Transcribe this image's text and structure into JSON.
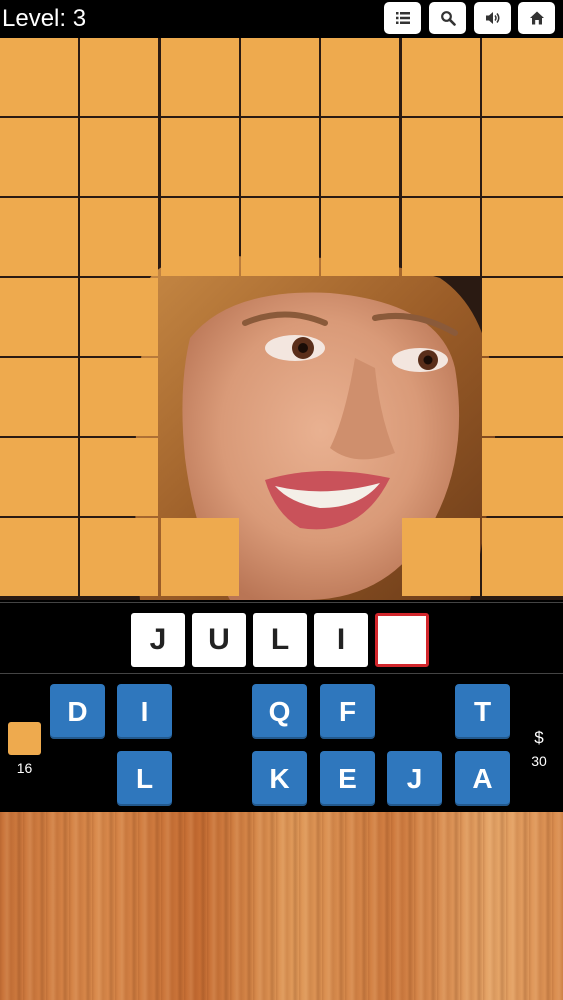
{
  "header": {
    "level_label": "Level: 3",
    "buttons": [
      {
        "name": "list-icon"
      },
      {
        "name": "search-icon"
      },
      {
        "name": "volume-icon"
      },
      {
        "name": "home-icon"
      }
    ]
  },
  "puzzle": {
    "grid_columns": 7,
    "grid_rows": 7,
    "tile_color": "#eeaa4e",
    "revealed_tiles": [
      [
        3,
        2
      ],
      [
        3,
        3
      ],
      [
        3,
        4
      ],
      [
        3,
        5
      ],
      [
        4,
        2
      ],
      [
        4,
        3
      ],
      [
        4,
        4
      ],
      [
        4,
        5
      ],
      [
        5,
        2
      ],
      [
        5,
        3
      ],
      [
        5,
        4
      ],
      [
        5,
        5
      ],
      [
        6,
        3
      ],
      [
        6,
        4
      ]
    ]
  },
  "answer": {
    "letters": [
      "J",
      "U",
      "L",
      "I",
      ""
    ],
    "active_index": 4
  },
  "keyboard": {
    "keys": [
      {
        "letter": "D",
        "row": 0,
        "col": 1
      },
      {
        "letter": "I",
        "row": 0,
        "col": 2
      },
      {
        "letter": "Q",
        "row": 0,
        "col": 4
      },
      {
        "letter": "F",
        "row": 0,
        "col": 5
      },
      {
        "letter": "T",
        "row": 0,
        "col": 7
      },
      {
        "letter": "L",
        "row": 1,
        "col": 2
      },
      {
        "letter": "K",
        "row": 1,
        "col": 4
      },
      {
        "letter": "E",
        "row": 1,
        "col": 5
      },
      {
        "letter": "J",
        "row": 1,
        "col": 6
      },
      {
        "letter": "A",
        "row": 1,
        "col": 7
      }
    ],
    "key_color": "#2f77bd"
  },
  "hints": {
    "count": "16"
  },
  "coins": {
    "symbol": "$",
    "count": "30"
  }
}
